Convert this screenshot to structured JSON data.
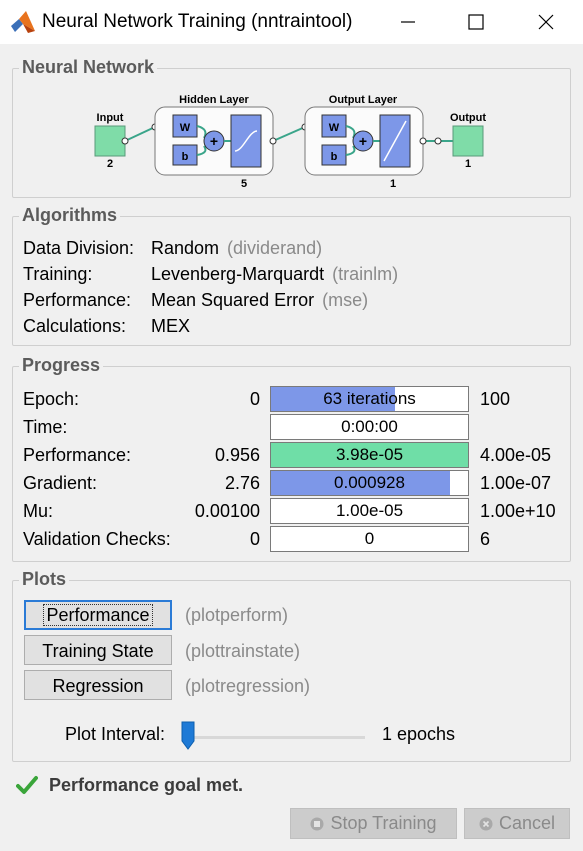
{
  "window": {
    "title": "Neural Network Training (nntraintool)",
    "controls": [
      "minimize-icon",
      "maximize-icon",
      "close-icon"
    ]
  },
  "network": {
    "legend": "Neural Network",
    "input_label": "Input",
    "input_size": "2",
    "hidden_label": "Hidden Layer",
    "hidden_size": "5",
    "output_layer_label": "Output Layer",
    "output_layer_size": "1",
    "output_label": "Output",
    "output_size": "1",
    "weight_symbol": "W",
    "bias_symbol": "b"
  },
  "algorithms": {
    "legend": "Algorithms",
    "rows": [
      {
        "key": "Data Division:",
        "value": "Random",
        "fn": "(dividerand)"
      },
      {
        "key": "Training:",
        "value": "Levenberg-Marquardt",
        "fn": "(trainlm)"
      },
      {
        "key": "Performance:",
        "value": "Mean Squared Error",
        "fn": "(mse)"
      },
      {
        "key": "Calculations:",
        "value": "MEX",
        "fn": ""
      }
    ]
  },
  "progress": {
    "legend": "Progress",
    "rows": [
      {
        "label": "Epoch:",
        "start": "0",
        "bar_text": "63 iterations",
        "end": "100",
        "fill_fraction": 0.63,
        "fill_color": "#7d97e8"
      },
      {
        "label": "Time:",
        "start": "",
        "bar_text": "0:00:00",
        "end": "",
        "fill_fraction": 0,
        "fill_color": "#ffffff"
      },
      {
        "label": "Performance:",
        "start": "0.956",
        "bar_text": "3.98e-05",
        "end": "4.00e-05",
        "fill_fraction": 1.0,
        "fill_color": "#6fdea7"
      },
      {
        "label": "Gradient:",
        "start": "2.76",
        "bar_text": "0.000928",
        "end": "1.00e-07",
        "fill_fraction": 0.91,
        "fill_color": "#7d97e8"
      },
      {
        "label": "Mu:",
        "start": "0.00100",
        "bar_text": "1.00e-05",
        "end": "1.00e+10",
        "fill_fraction": 0,
        "fill_color": "#ffffff"
      },
      {
        "label": "Validation Checks:",
        "start": "0",
        "bar_text": "0",
        "end": "6",
        "fill_fraction": 0,
        "fill_color": "#ffffff"
      }
    ]
  },
  "plots": {
    "legend": "Plots",
    "buttons": [
      {
        "label": "Performance",
        "fn": "(plotperform)"
      },
      {
        "label": "Training State",
        "fn": "(plottrainstate)"
      },
      {
        "label": "Regression",
        "fn": "(plotregression)"
      }
    ],
    "interval_label": "Plot Interval:",
    "interval_value": "1 epochs"
  },
  "status": {
    "text": "Performance goal met.",
    "icon": "checkmark-icon",
    "color": "#3aa53a"
  },
  "footer": {
    "stop_label": "Stop Training",
    "cancel_label": "Cancel"
  }
}
